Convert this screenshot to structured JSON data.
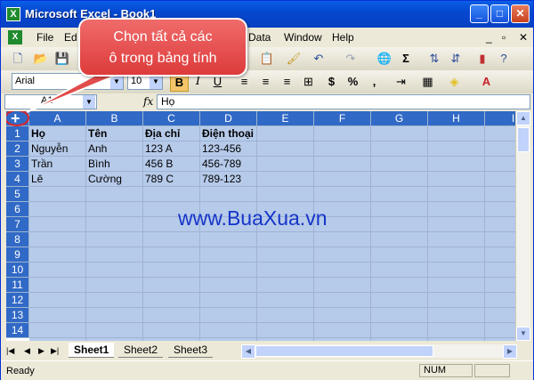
{
  "window": {
    "title": "Microsoft Excel - Book1",
    "minimize": "_",
    "restore": "□",
    "close": "✕"
  },
  "menubar": {
    "items": [
      "File",
      "Ed",
      "Data",
      "Window",
      "Help"
    ],
    "right_controls": [
      "_",
      "▫",
      "✕"
    ]
  },
  "toolbar": {
    "font_name": "Arial",
    "font_size": "10",
    "bold": "B",
    "italic": "I",
    "underline": "U",
    "currency": "$",
    "percent": "%",
    "comma": ",",
    "sum": "Σ"
  },
  "formula_bar": {
    "name_box": "A1",
    "fx": "fx",
    "content": "Họ"
  },
  "grid": {
    "columns": [
      "A",
      "B",
      "C",
      "D",
      "E",
      "F",
      "G",
      "H",
      "I"
    ],
    "rows": [
      "1",
      "2",
      "3",
      "4",
      "5",
      "6",
      "7",
      "8",
      "9",
      "10",
      "11",
      "12",
      "13",
      "14"
    ],
    "header": [
      "Họ",
      "Tên",
      "Địa chỉ",
      "Điện thoại"
    ],
    "data": [
      [
        "Nguyễn",
        "Anh",
        "123 A",
        "123-456"
      ],
      [
        "Trần",
        "Bình",
        "456 B",
        "456-789"
      ],
      [
        "Lê",
        "Cường",
        "789 C",
        "789-123"
      ]
    ]
  },
  "sheet_tabs": [
    "Sheet1",
    "Sheet2",
    "Sheet3"
  ],
  "tab_nav": [
    "|◀",
    "◀",
    "▶",
    "▶|"
  ],
  "status": {
    "ready": "Ready",
    "num": "NUM"
  },
  "callout": {
    "line1": "Chọn tất cả các",
    "line2": "ô trong bảng tính"
  },
  "watermark": "www.BuaXua.vn",
  "colors": {
    "title_blue": "#0548d0",
    "selection_fill": "#b6caea",
    "header_blue": "#3169c6",
    "callout_red": "#e24c4c",
    "watermark_blue": "#1535c8"
  }
}
